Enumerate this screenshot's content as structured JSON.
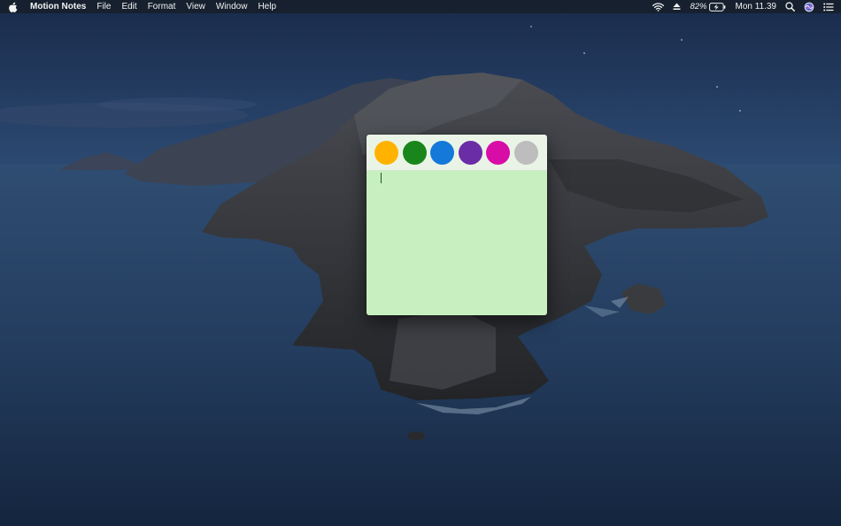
{
  "menubar": {
    "app_name": "Motion Notes",
    "menus": [
      {
        "label": "File"
      },
      {
        "label": "Edit"
      },
      {
        "label": "Format"
      },
      {
        "label": "View"
      },
      {
        "label": "Window"
      },
      {
        "label": "Help"
      }
    ],
    "status": {
      "battery_percent": "82%",
      "clock": "Mon 11.39",
      "icons": [
        "wifi-icon",
        "eject-icon",
        "battery-charging-icon",
        "spotlight-search-icon",
        "siri-icon",
        "notification-center-icon"
      ]
    }
  },
  "note": {
    "color_swatches": [
      {
        "name": "orange",
        "color": "#FFB300"
      },
      {
        "name": "green",
        "color": "#18861A"
      },
      {
        "name": "blue",
        "color": "#1479D8"
      },
      {
        "name": "purple",
        "color": "#6A2DA6"
      },
      {
        "name": "magenta",
        "color": "#D80CA7"
      },
      {
        "name": "gray",
        "color": "#BDBDBD"
      }
    ],
    "selected_color": "#C8EFC0",
    "toolbar_color": "#EAF4E6",
    "text": ""
  }
}
